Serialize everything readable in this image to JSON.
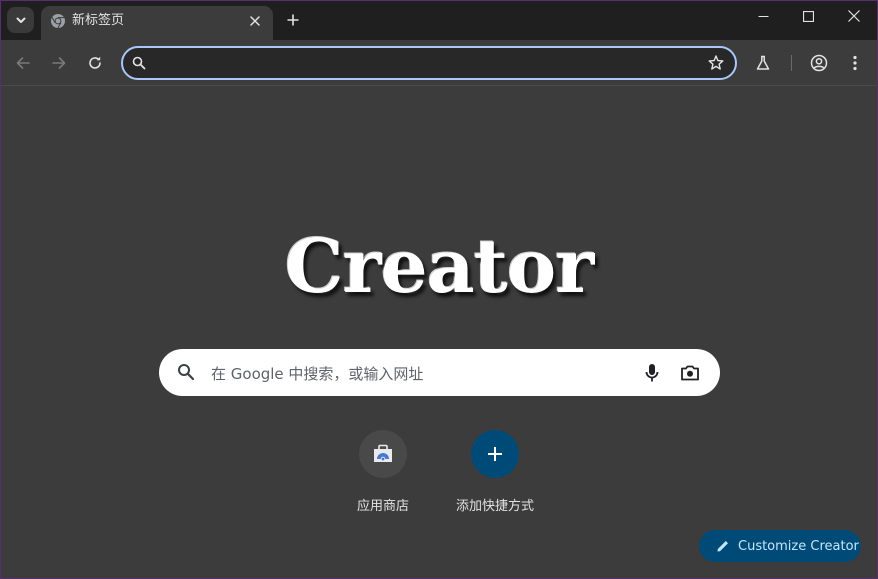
{
  "browser": {
    "tab": {
      "title": "新标签页"
    },
    "omnibox": {
      "value": "",
      "placeholder": ""
    }
  },
  "ntp": {
    "logo_text": "Creator",
    "search": {
      "placeholder": "在 Google 中搜索，或输入网址"
    },
    "shortcuts": [
      {
        "label": "应用商店",
        "icon": "web-store-icon"
      },
      {
        "label": "添加快捷方式",
        "icon": "plus-icon"
      }
    ],
    "customize_label": "Customize Creator"
  },
  "colors": {
    "page_bg": "#3c3c3c",
    "titlebar_bg": "#1f1f1f",
    "omnibox_border": "#a8c7fa",
    "accent_button": "#004a77",
    "accent_text": "#c2e7ff"
  }
}
